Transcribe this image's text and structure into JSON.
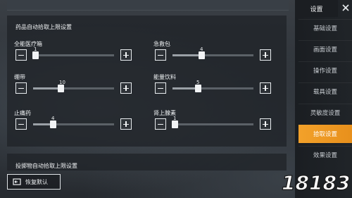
{
  "sidebar": {
    "header": "设置",
    "items": [
      {
        "label": "基础设置",
        "active": false
      },
      {
        "label": "画面设置",
        "active": false
      },
      {
        "label": "操作设置",
        "active": false
      },
      {
        "label": "载具设置",
        "active": false
      },
      {
        "label": "灵敏度设置",
        "active": false
      },
      {
        "label": "拾取设置",
        "active": true
      },
      {
        "label": "效果设置",
        "active": false
      }
    ],
    "active_color": "#f2a12a"
  },
  "sections": {
    "medicine_title": "药品自动拾取上限设置",
    "throwable_title": "投掷物自动拾取上限设置"
  },
  "sliders": [
    {
      "label": "全能医疗箱",
      "value": "1",
      "level": 1,
      "max": 10
    },
    {
      "label": "急救包",
      "value": "4",
      "level": 4,
      "max": 10
    },
    {
      "label": "绷带",
      "value": "10",
      "level": 10,
      "max": 30
    },
    {
      "label": "能量饮料",
      "value": "5",
      "level": 5,
      "max": 15
    },
    {
      "label": "止痛药",
      "value": "4",
      "level": 4,
      "max": 15
    },
    {
      "label": "肾上腺素",
      "value": "1",
      "level": 1,
      "max": 10
    }
  ],
  "reset_label": "恢复默认",
  "watermark": "18183",
  "icons": {
    "minus": "minus-icon",
    "plus": "plus-icon",
    "reset": "reset-icon",
    "close": "close-icon"
  }
}
